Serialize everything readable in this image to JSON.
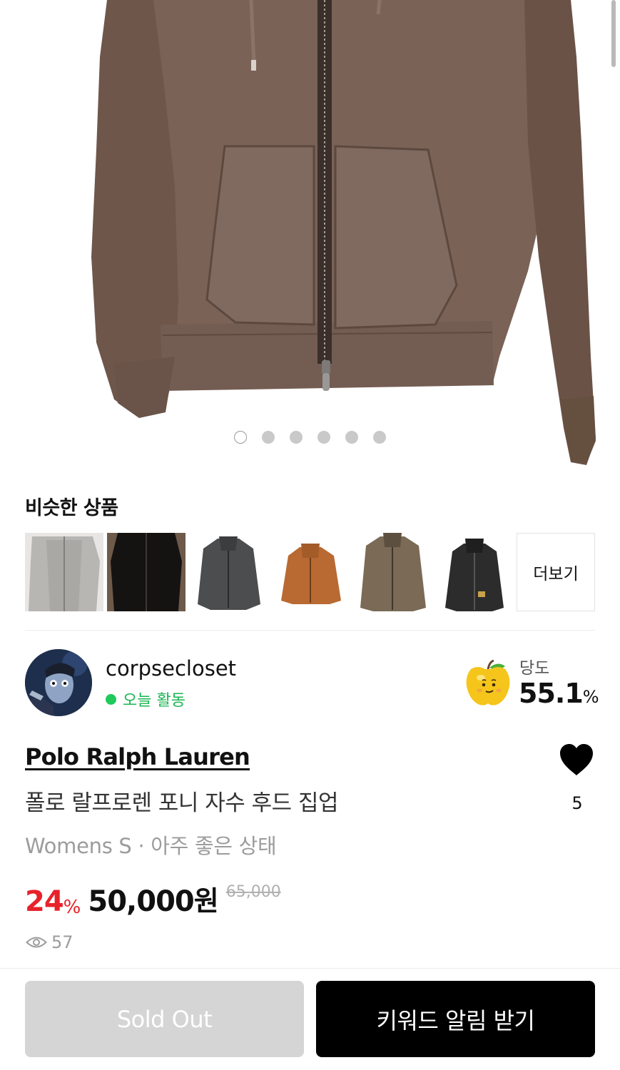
{
  "gallery": {
    "image_subject": "brown-zip-hoodie",
    "dot_count": 6,
    "active_dot": 0
  },
  "similar": {
    "title": "비슷한 상품",
    "thumbnails": [
      "gray-zip-hoodie",
      "black-zip-jacket",
      "charcoal-hoodie",
      "orange-hoodie",
      "brown-hoodie",
      "black-carhartt-hoodie"
    ],
    "more_label": "더보기"
  },
  "seller": {
    "name": "corpsecloset",
    "status": "오늘 활동",
    "status_color": "#1fc95c",
    "sweetness_label": "당도",
    "sweetness_value": "55.1",
    "sweetness_unit": "%"
  },
  "product": {
    "brand": "Polo Ralph Lauren",
    "name": "폴로 랄프로렌 포니 자수 후드 집업",
    "meta": "Womens S · 아주 좋은 상태",
    "like_count": "5",
    "discount": "24",
    "discount_unit": "%",
    "price": "50,000",
    "price_unit": "원",
    "original_price": "65,000",
    "views": "57"
  },
  "actions": {
    "sold_out_label": "Sold Out",
    "keyword_alert_label": "키워드 알림 받기"
  },
  "colors": {
    "discount_red": "#e8222a",
    "active_green": "#18b551",
    "primary_button": "#000000",
    "disabled_button": "#d5d5d5"
  }
}
